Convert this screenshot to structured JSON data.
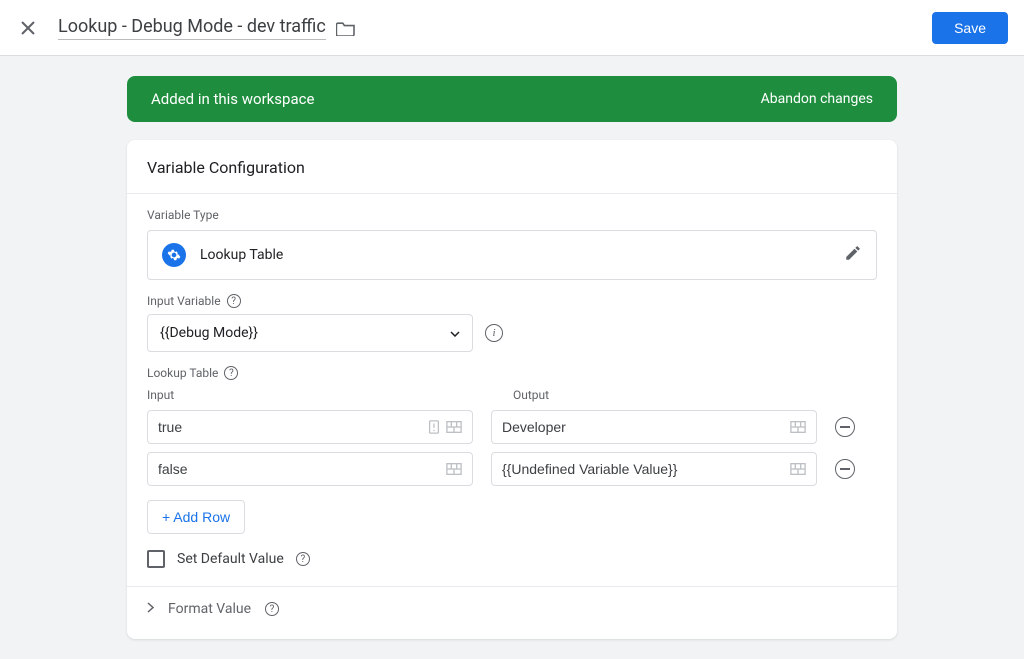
{
  "header": {
    "title": "Lookup - Debug Mode - dev traffic",
    "save_label": "Save"
  },
  "banner": {
    "message": "Added in this workspace",
    "action": "Abandon changes"
  },
  "config": {
    "heading": "Variable Configuration",
    "type_label": "Variable Type",
    "type_name": "Lookup Table",
    "input_var_label": "Input Variable",
    "input_var_value": "{{Debug Mode}}",
    "table_label": "Lookup Table",
    "col_input": "Input",
    "col_output": "Output",
    "rows": [
      {
        "input": "true",
        "output": "Developer"
      },
      {
        "input": "false",
        "output": "{{Undefined Variable Value}}"
      }
    ],
    "add_row_label": "+ Add Row",
    "default_label": "Set Default Value",
    "format_label": "Format Value"
  }
}
